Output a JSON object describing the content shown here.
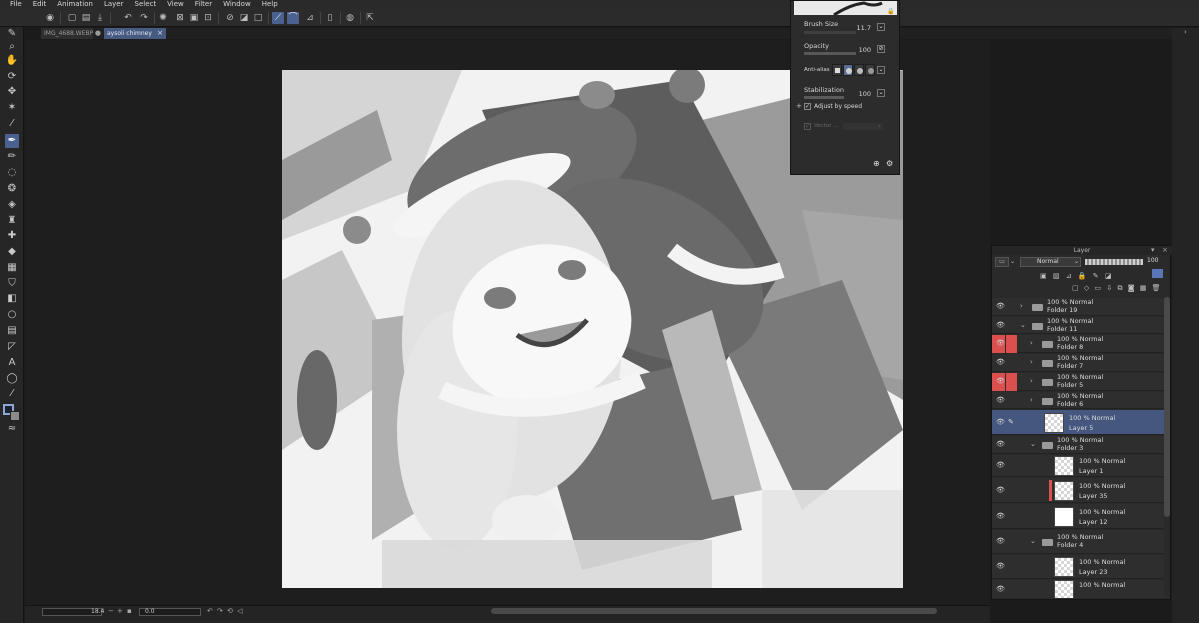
{
  "menu": [
    "File",
    "Edit",
    "Animation",
    "Layer",
    "Select",
    "View",
    "Filter",
    "Window",
    "Help"
  ],
  "tabs": [
    {
      "label": "IMG_4688.WEBP",
      "active": false
    },
    {
      "label": "aysoli chimney",
      "active": true
    }
  ],
  "tool_property": {
    "brush_size_label": "Brush Size",
    "brush_size_value": "11.7",
    "opacity_label": "Opacity",
    "opacity_value": "100",
    "antialias_label": "Anti-alias",
    "stabilization_label": "Stabilization",
    "stabilization_value": "100",
    "adjust_label": "Adjust by speed",
    "vector_label": "Vector ..."
  },
  "layer_panel": {
    "title": "Layer",
    "blend_mode": "Normal",
    "opacity": "100",
    "layers": [
      {
        "mode": "100 % Normal",
        "name": "Folder 19",
        "type": "folder",
        "depth": 0,
        "expanded": false,
        "color": false,
        "selected": false,
        "thumb": ""
      },
      {
        "mode": "100 % Normal",
        "name": "Folder 11",
        "type": "folder",
        "depth": 0,
        "expanded": true,
        "color": false,
        "selected": false,
        "thumb": ""
      },
      {
        "mode": "100 % Normal",
        "name": "Folder 8",
        "type": "folder",
        "depth": 1,
        "expanded": false,
        "color": true,
        "selected": false,
        "thumb": ""
      },
      {
        "mode": "100 % Normal",
        "name": "Folder 7",
        "type": "folder",
        "depth": 1,
        "expanded": false,
        "color": false,
        "selected": false,
        "thumb": ""
      },
      {
        "mode": "100 % Normal",
        "name": "Folder 5",
        "type": "folder",
        "depth": 1,
        "expanded": false,
        "color": true,
        "selected": false,
        "thumb": ""
      },
      {
        "mode": "100 % Normal",
        "name": "Folder 6",
        "type": "folder",
        "depth": 1,
        "expanded": false,
        "color": false,
        "selected": false,
        "thumb": ""
      },
      {
        "mode": "100 % Normal",
        "name": "Layer 5",
        "type": "layer",
        "depth": 1,
        "expanded": false,
        "color": false,
        "selected": true,
        "thumb": "sketch"
      },
      {
        "mode": "100 % Normal",
        "name": "Folder 3",
        "type": "folder",
        "depth": 1,
        "expanded": true,
        "color": false,
        "selected": false,
        "thumb": ""
      },
      {
        "mode": "100 % Normal",
        "name": "Layer 1",
        "type": "layer",
        "depth": 2,
        "expanded": false,
        "color": false,
        "selected": false,
        "thumb": "transparent"
      },
      {
        "mode": "100 % Normal",
        "name": "Layer 35",
        "type": "layer",
        "depth": 2,
        "expanded": false,
        "color": false,
        "selected": false,
        "thumb": "transparent",
        "clip": true
      },
      {
        "mode": "100 % Normal",
        "name": "Layer 12",
        "type": "layer",
        "depth": 2,
        "expanded": false,
        "color": false,
        "selected": false,
        "thumb": "white"
      },
      {
        "mode": "100 % Normal",
        "name": "Folder 4",
        "type": "folder",
        "depth": 1,
        "expanded": true,
        "color": false,
        "selected": false,
        "thumb": ""
      },
      {
        "mode": "100 % Normal",
        "name": "Layer 23",
        "type": "layer",
        "depth": 2,
        "expanded": false,
        "color": false,
        "selected": false,
        "thumb": "transparent"
      },
      {
        "mode": "100 % Normal",
        "name": "",
        "type": "layer",
        "depth": 2,
        "expanded": false,
        "color": false,
        "selected": false,
        "thumb": "transparent"
      }
    ]
  },
  "status": {
    "zoom": "18.4",
    "rotation": "0.0"
  },
  "colors": {
    "accent": "#4b6291",
    "label_red": "#dc4f4f",
    "panel": "#2a2a2a"
  }
}
